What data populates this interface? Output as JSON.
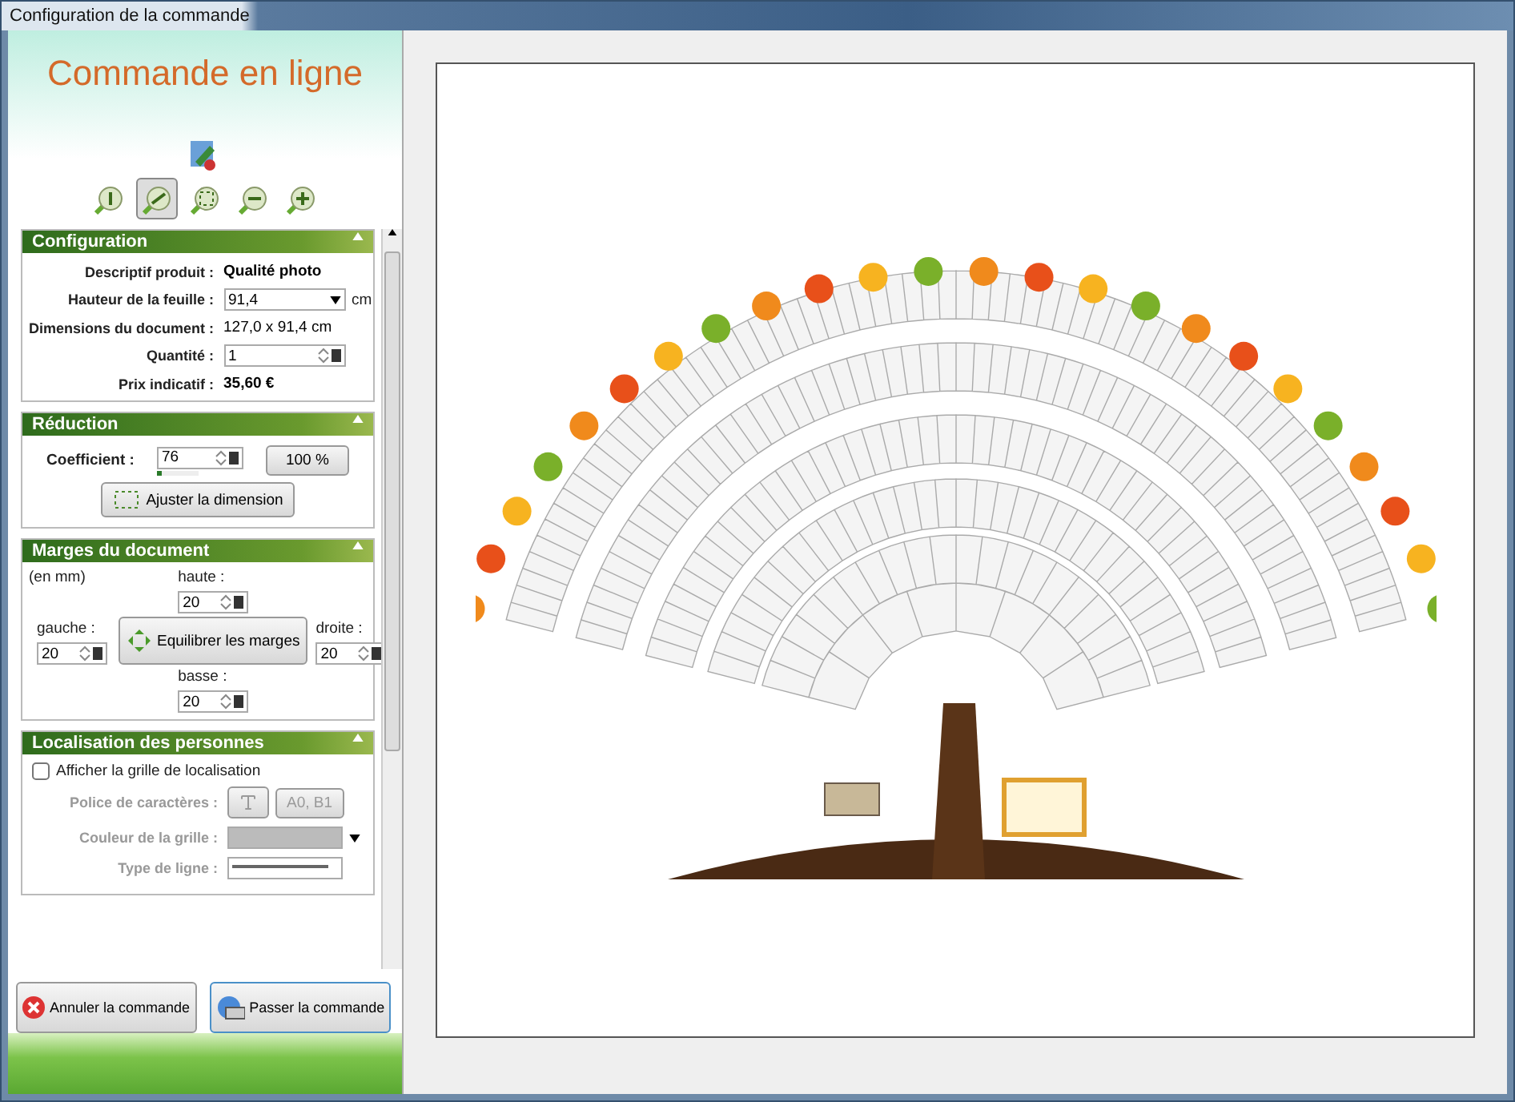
{
  "window": {
    "title": "Configuration de la commande"
  },
  "header": {
    "title": "Commande en ligne"
  },
  "zoom_tools": [
    {
      "kind": "one",
      "selected": false
    },
    {
      "kind": "fit-width",
      "selected": true
    },
    {
      "kind": "fit-page",
      "selected": false
    },
    {
      "kind": "minus",
      "selected": false
    },
    {
      "kind": "plus",
      "selected": false
    }
  ],
  "configuration": {
    "title": "Configuration",
    "rows": [
      {
        "kind": "text",
        "label": "Descriptif produit :",
        "value": "Qualité photo",
        "bold": true
      },
      {
        "kind": "select",
        "label": "Hauteur de la feuille :",
        "value": "91,4",
        "unit": "cm"
      },
      {
        "kind": "text",
        "label": "Dimensions du document :",
        "value": "127,0 x 91,4 cm",
        "bold": false
      },
      {
        "kind": "spin",
        "label": "Quantité :",
        "value": "1"
      },
      {
        "kind": "text",
        "label": "Prix indicatif :",
        "value": "35,60 €",
        "bold": true
      }
    ]
  },
  "reduction": {
    "title": "Réduction",
    "label": "Coefficient :",
    "value": "76",
    "level": 0.1,
    "reset_button": "100 %",
    "fit_button": "Ajuster la dimension"
  },
  "margins": {
    "title": "Marges du document",
    "unit_note": "(en mm)",
    "top": {
      "label": "haute :",
      "value": "20"
    },
    "left": {
      "label": "gauche :",
      "value": "20"
    },
    "right": {
      "label": "droite :",
      "value": "20"
    },
    "bottom": {
      "label": "basse :",
      "value": "20"
    },
    "balance_button": "Equilibrer les marges"
  },
  "localisation": {
    "title": "Localisation des personnes",
    "show_grid": {
      "label": "Afficher la grille de localisation",
      "checked": false
    },
    "font": {
      "label": "Police de caractères :",
      "sample": "A0, B1"
    },
    "grid_color": {
      "label": "Couleur de la grille :"
    },
    "line_type": {
      "label": "Type de ligne :"
    },
    "disabled": true
  },
  "actions": [
    {
      "kind": "cancel",
      "label": "Annuler la commande"
    },
    {
      "kind": "submit",
      "label": "Passer la commande"
    }
  ]
}
